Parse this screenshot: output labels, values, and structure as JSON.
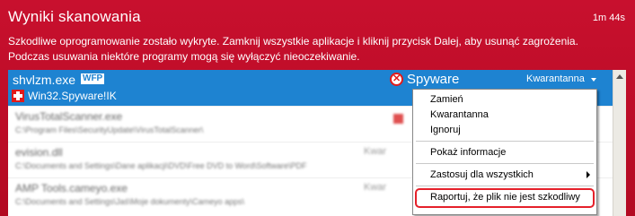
{
  "header": {
    "title": "Wyniki skanowania",
    "elapsed": "1m 44s",
    "description_line1": "Szkodliwe oprogramowanie zostało wykryte. Zamknij wszystkie aplikacje i kliknij przycisk Dalej, aby usunąć zagrożenia.",
    "description_line2": "Podczas usuwania niektóre programy mogą się wyłączyć nieoczekiwanie."
  },
  "selected_item": {
    "name": "shvlzm.exe",
    "badge": "WFP",
    "threat": "Win32.Spyware!IK",
    "category": "Spyware",
    "action": "Kwarantanna"
  },
  "blurred_rows": [
    {
      "name": "VirusTotalScanner.exe",
      "path": "C:\\Program Files\\SecurityUpdate\\VirusTotalScanner\\",
      "status": ""
    },
    {
      "name": "evision.dll",
      "path": "C:\\Documents and Settings\\Dane aplikacji\\DVD\\Free DVD to Word\\Software\\PDF",
      "status": "Kwar"
    },
    {
      "name": "AMP Tools.cameyo.exe",
      "path": "C:\\Documents and Settings\\Jaś\\Moje dokumenty\\Cameyo apps\\",
      "status": "Kwar"
    }
  ],
  "context_menu": {
    "items": [
      "Zamień",
      "Kwarantanna",
      "Ignoruj"
    ],
    "info": "Pokaż informacje",
    "apply_all": "Zastosuj dla wszystkich",
    "report": "Raportuj, że plik nie jest szkodliwy"
  },
  "colors": {
    "panel": "#c8102e",
    "selection": "#1e83d1",
    "highlight": "#e5202a"
  }
}
